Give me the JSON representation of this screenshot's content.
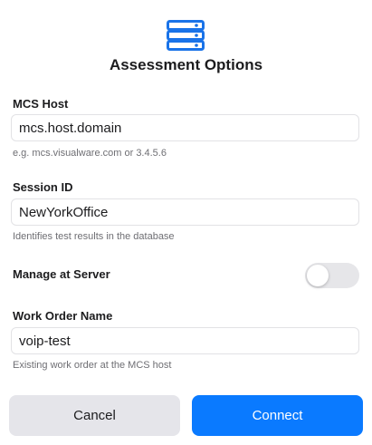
{
  "icon": {
    "name": "server-stack-icon",
    "color": "#1a73e8"
  },
  "dialog": {
    "title": "Assessment Options"
  },
  "mcs_host": {
    "label": "MCS Host",
    "value": "mcs.host.domain",
    "hint": "e.g. mcs.visualware.com or 3.4.5.6"
  },
  "session_id": {
    "label": "Session ID",
    "value": "NewYorkOffice",
    "hint": "Identifies test results in the database"
  },
  "manage_at_server": {
    "label": "Manage at Server",
    "enabled": false
  },
  "work_order": {
    "label": "Work Order Name",
    "value": "voip-test",
    "hint": "Existing work order at the MCS host"
  },
  "buttons": {
    "cancel_label": "Cancel",
    "connect_label": "Connect"
  },
  "colors": {
    "accent": "#0a7aff",
    "cancel_bg": "#e5e5ea"
  }
}
